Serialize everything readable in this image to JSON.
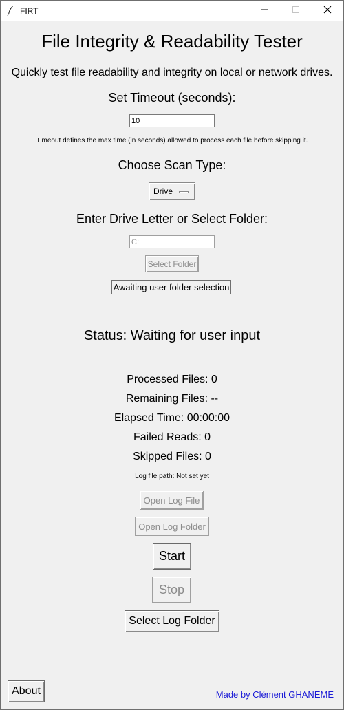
{
  "window": {
    "title": "FIRT"
  },
  "header": {
    "title": "File Integrity & Readability Tester",
    "subtitle": "Quickly test file readability and integrity on local or network drives."
  },
  "timeout": {
    "label": "Set Timeout (seconds):",
    "value": "10",
    "help": "Timeout defines the max time (in seconds) allowed to process each file before skipping it."
  },
  "scan": {
    "label": "Choose Scan Type:",
    "selected": "Drive"
  },
  "target": {
    "label": "Enter Drive Letter or Select Folder:",
    "value": "C:",
    "select_folder_label": "Select Folder",
    "selection_status": "Awaiting user folder selection"
  },
  "status": {
    "text": "Status: Waiting for user input",
    "processed": "Processed Files: 0",
    "remaining": "Remaining Files: --",
    "elapsed": "Elapsed Time: 00:00:00",
    "failed": "Failed Reads: 0",
    "skipped": "Skipped Files: 0",
    "log_path": "Log file path: Not set yet"
  },
  "buttons": {
    "open_log_file": "Open Log File",
    "open_log_folder": "Open Log Folder",
    "start": "Start",
    "stop": "Stop",
    "select_log_folder": "Select Log Folder",
    "about": "About"
  },
  "footer": {
    "credit": "Made by Clément GHANEME"
  },
  "colors": {
    "credit": "#1b1bd6",
    "background": "#f0f0f0"
  },
  "icons": {
    "app": "feather-icon",
    "minimize": "minimize-icon",
    "maximize": "maximize-icon",
    "close": "close-icon"
  }
}
